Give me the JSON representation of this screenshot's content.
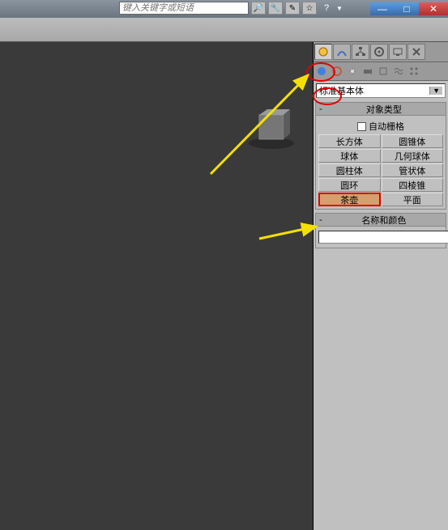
{
  "search": {
    "placeholder": "键入关键字或短语"
  },
  "window_controls": {
    "min": "—",
    "max": "□",
    "close": "✕"
  },
  "dropdown": {
    "selected": "标准基本体"
  },
  "rollout_object_type": {
    "title": "对象类型",
    "auto_grid": "自动栅格",
    "buttons": [
      "长方体",
      "圆锥体",
      "球体",
      "几何球体",
      "圆柱体",
      "管状体",
      "圆环",
      "四棱锥",
      "茶壶",
      "平面"
    ],
    "highlighted": "茶壶"
  },
  "rollout_name_color": {
    "title": "名称和颜色",
    "name_value": "",
    "color": "#ff3399"
  },
  "colors": {
    "highlight_red": "#e00000",
    "arrow_yellow": "#f5e000"
  }
}
